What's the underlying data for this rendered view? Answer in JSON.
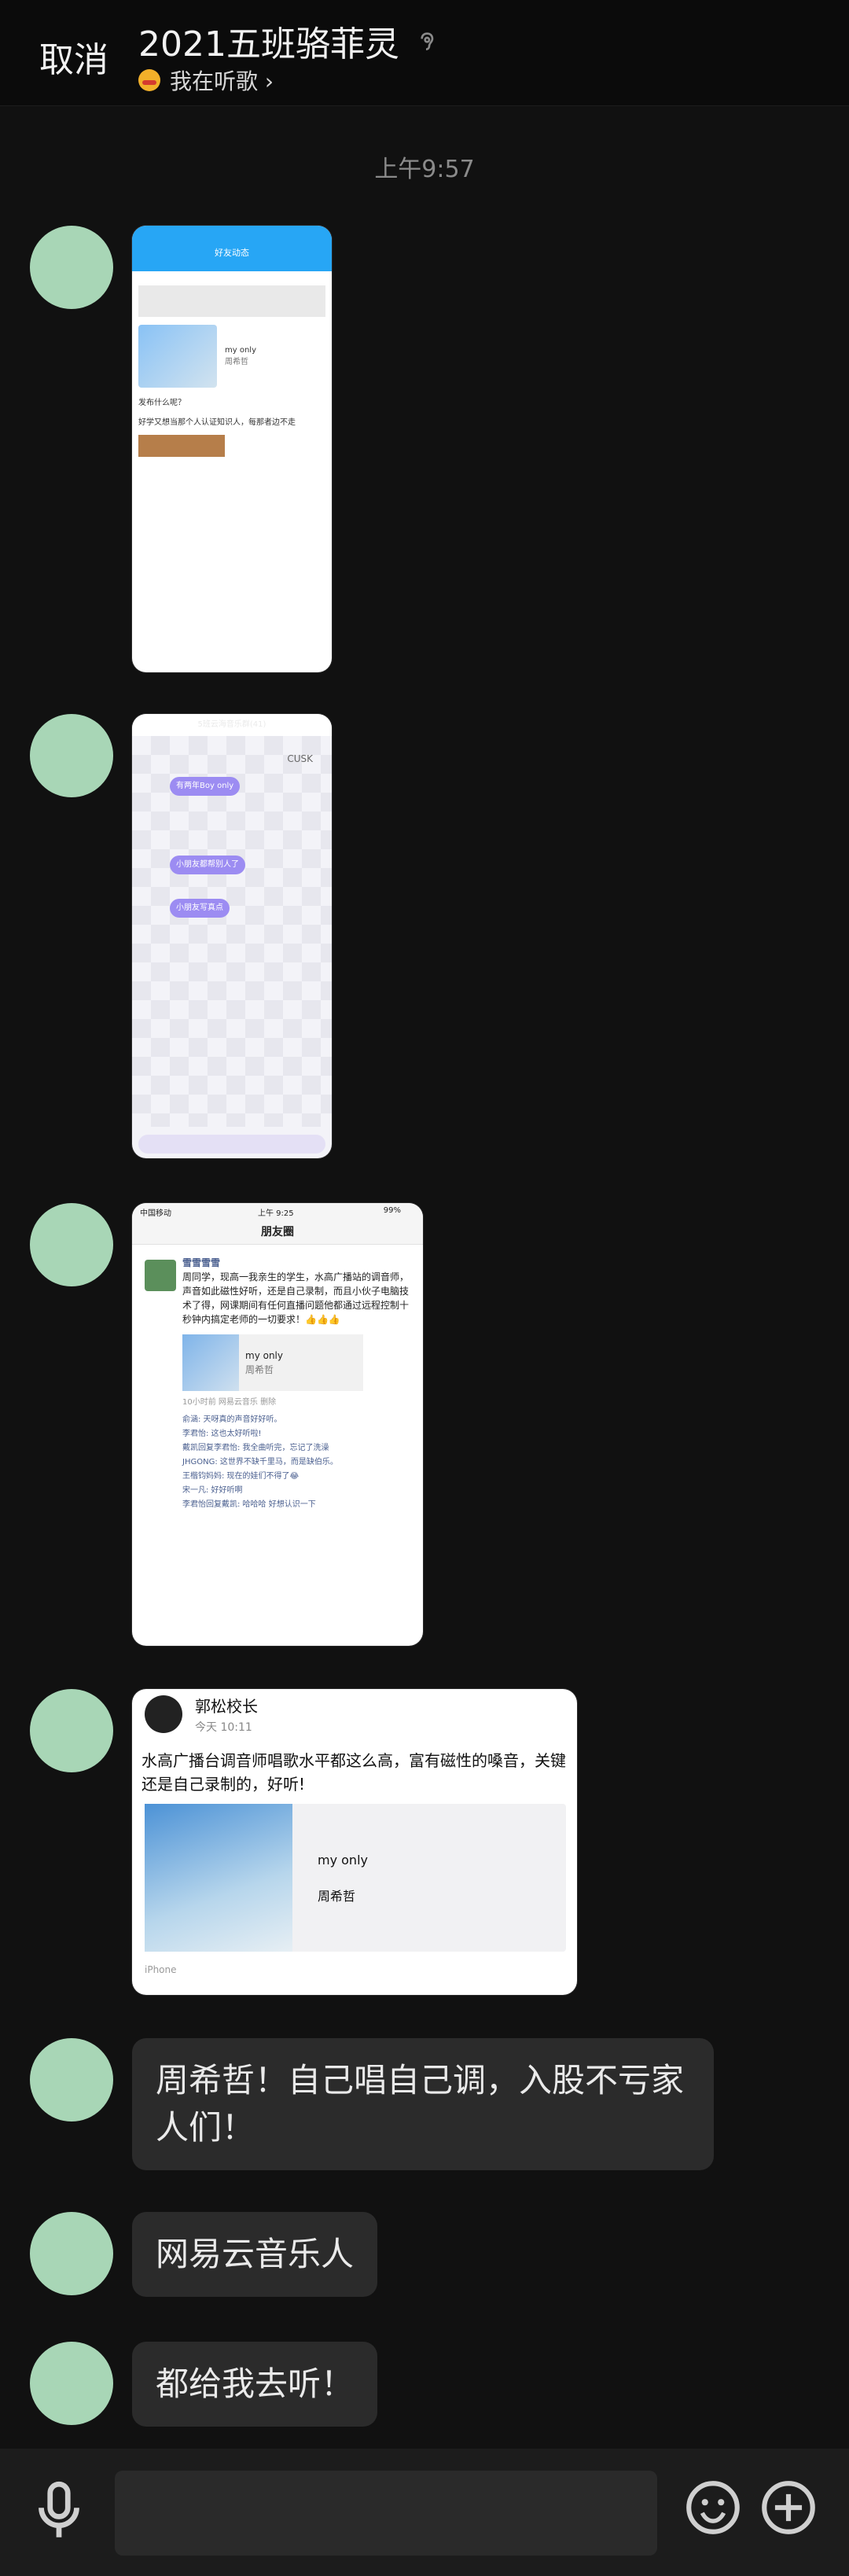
{
  "header": {
    "cancel": "取消",
    "title": "2021五班骆菲灵",
    "subtitle": "我在听歌 ›"
  },
  "timestamp": "上午9:57",
  "screenshots": {
    "s1": {
      "title": "好友动态",
      "song": "my only",
      "artist": "周希哲",
      "caption1": "发布什么呢？",
      "caption2": "好学又想当那个人认证知识人，每那者边不走"
    },
    "s2": {
      "header": "5班云海音乐群(41)",
      "brand": "CUSK",
      "chip1": "有两年Boy only",
      "chip2": "小朋友都帮别人了",
      "chip3": "小朋友写真点"
    },
    "s3": {
      "status_carrier": "中国移动",
      "status_time": "上午 9:25",
      "status_battery": "99%",
      "title": "朋友圈",
      "poster": "雪雪雪雪",
      "text": "周同学，现高一我亲生的学生，水高广播站的调音师，声音如此磁性好听，还是自己录制，而且小伙子电脑技术了得，网课期间有任何直播问题他都通过远程控制十秒钟内搞定老师的一切要求！👍👍👍",
      "song": "my only",
      "artist": "周希哲",
      "footer": "10小时前   网易云音乐 删除",
      "comment1": "俞涵: 天呀真的声音好好听。",
      "comment2": "李君怡: 这也太好听啦!",
      "comment3": "戴凯回复李君怡: 我全曲听完，忘记了洗澡",
      "comment4": "JHGONG: 这世界不缺千里马，而是缺伯乐。",
      "comment5": "王楷钧妈妈: 现在的娃们不得了😂",
      "comment6": "宋一凡: 好好听啊",
      "comment7": "李君怡回复戴凯: 哈哈哈 好想认识一下"
    },
    "s4": {
      "name": "郭松校长",
      "time": "今天 10:11",
      "text": "水高广播台调音师唱歌水平都这么高，富有磁性的嗓音，关键还是自己录制的，好听!",
      "song": "my only",
      "artist": "周希哲",
      "device": "iPhone"
    }
  },
  "messages": [
    {
      "text": "周希哲！自己唱自己调，入股不亏家人们！"
    },
    {
      "text": "网易云音乐人"
    },
    {
      "text": "都给我去听！"
    }
  ],
  "colors": {
    "avatar": "#a8d6b6",
    "bubble": "#2b2b2b",
    "background": "#111111"
  }
}
